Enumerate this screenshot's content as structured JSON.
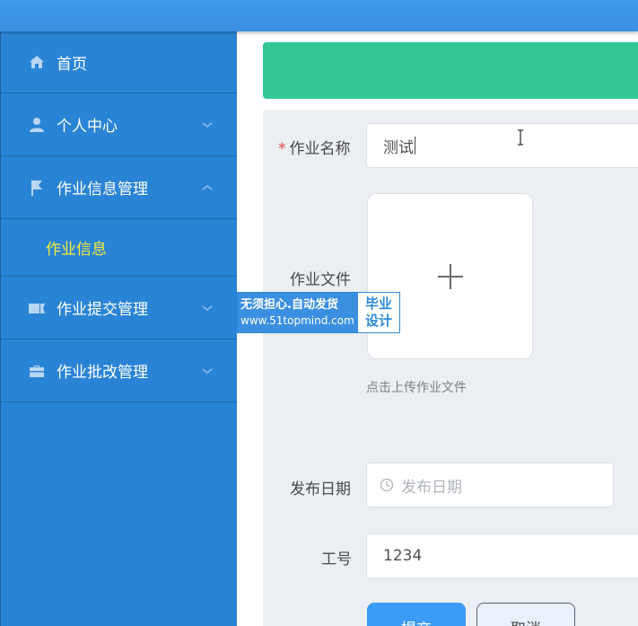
{
  "sidebar": {
    "items": [
      {
        "label": "首页",
        "icon": "home-icon"
      },
      {
        "label": "个人中心",
        "icon": "user-icon"
      },
      {
        "label": "作业信息管理",
        "icon": "flag-icon",
        "expanded": true
      },
      {
        "label": "作业提交管理",
        "icon": "ticket-icon"
      },
      {
        "label": "作业批改管理",
        "icon": "briefcase-icon"
      }
    ],
    "submenu": [
      {
        "label": "作业信息"
      }
    ]
  },
  "form": {
    "name": {
      "label": "作业名称",
      "required_mark": "*",
      "value": "测试"
    },
    "file": {
      "label": "作业文件",
      "hint": "点击上传作业文件"
    },
    "date": {
      "label": "发布日期",
      "placeholder": "发布日期"
    },
    "staff_id": {
      "label": "工号",
      "value": "1234"
    },
    "submit_label": "提交",
    "cancel_label": "取消"
  },
  "watermark": {
    "line1": "无须担心.自动发货",
    "line2": "www.51topmind.com",
    "right1": "毕业",
    "right2": "设计"
  },
  "colors": {
    "topbar": "#3f98ea",
    "sidebar": "#2a84d5",
    "active_submenu_text": "#f5ea3b",
    "banner": "#33c795",
    "primary_button": "#3a9cf5",
    "required": "#e5443a"
  }
}
